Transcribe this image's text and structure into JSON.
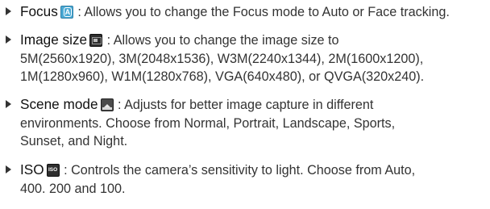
{
  "items": [
    {
      "term": "Focus",
      "icon": "focus-auto-icon",
      "lines": [
        ": Allows you to change the Focus mode to Auto or Face tracking."
      ]
    },
    {
      "term": "Image size",
      "icon": "image-size-icon",
      "lines": [
        ": Allows you to change the image size to",
        "5M(2560x1920), 3M(2048x1536), W3M(2240x1344), 2M(1600x1200),",
        "1M(1280x960), W1M(1280x768), VGA(640x480), or QVGA(320x240)."
      ]
    },
    {
      "term": "Scene mode",
      "icon": "scene-mode-icon",
      "lines": [
        ": Adjusts for better image capture in different",
        "environments. Choose from Normal, Portrait, Landscape, Sports,",
        "Sunset, and Night."
      ]
    },
    {
      "term": "ISO",
      "icon": "iso-icon",
      "lines": [
        ": Controls the camera’s sensitivity to light. Choose from Auto,",
        "400. 200 and 100."
      ]
    }
  ]
}
